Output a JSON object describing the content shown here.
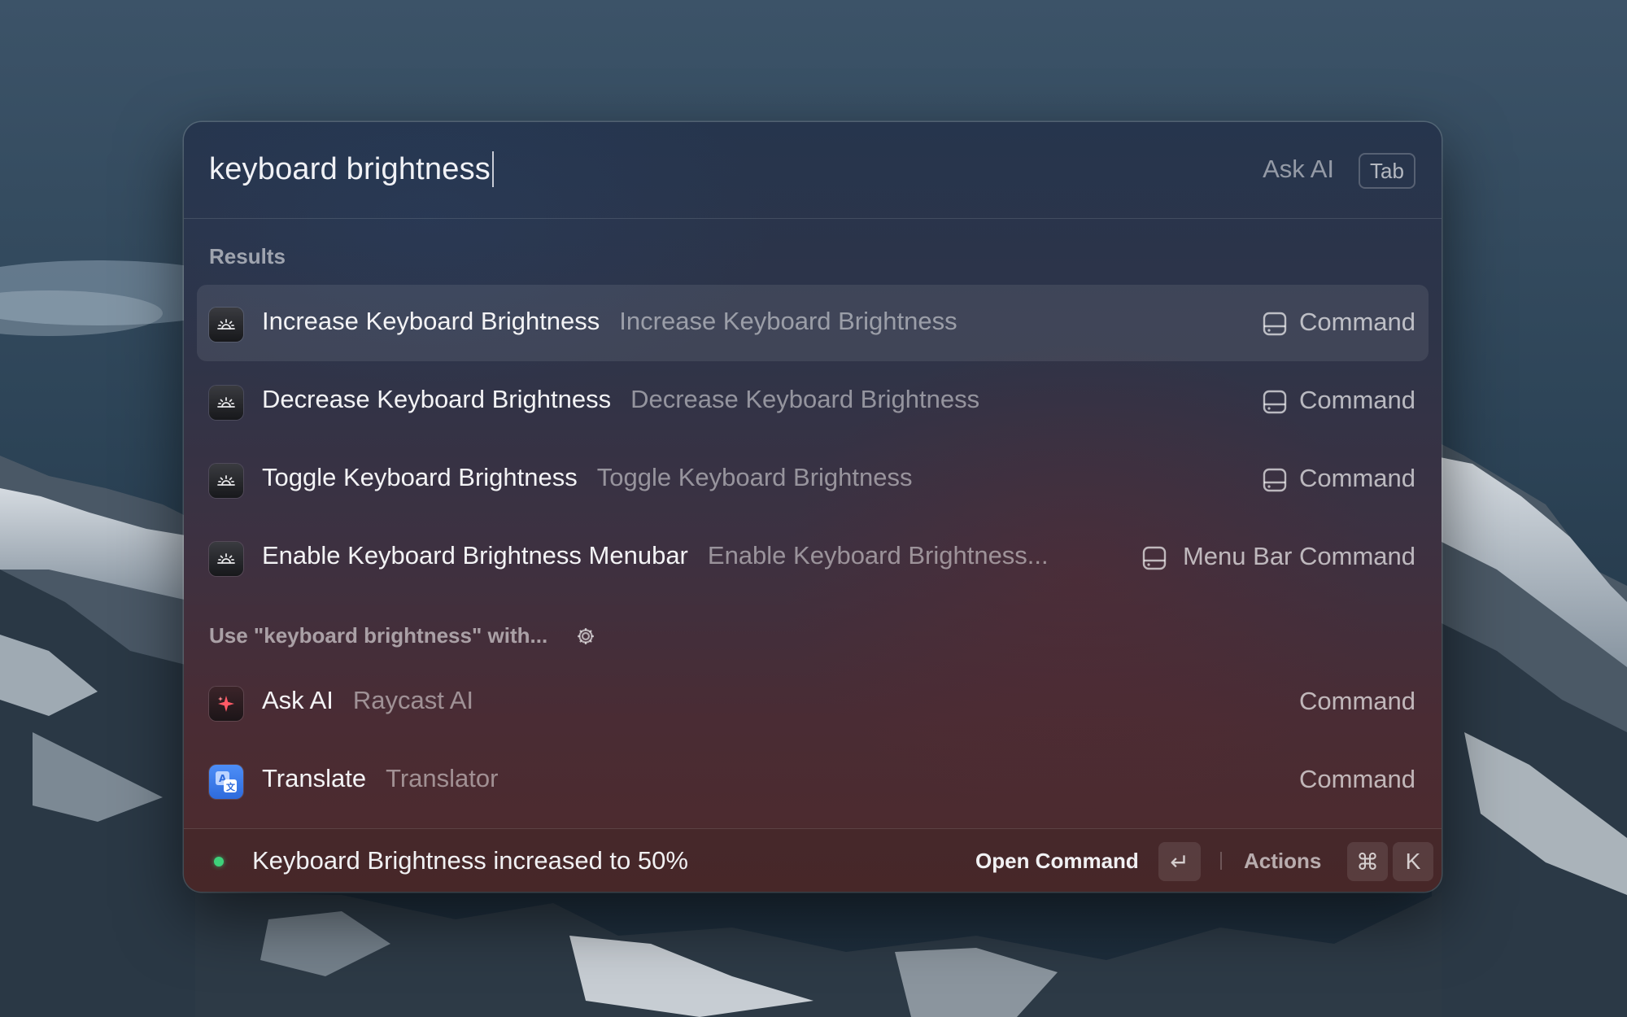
{
  "search": {
    "query": "keyboard brightness",
    "ask_ai_hint": "Ask AI",
    "tab_key": "Tab"
  },
  "results_section": {
    "header": "Results",
    "items": [
      {
        "title": "Increase Keyboard Brightness",
        "subtitle": "Increase Keyboard Brightness",
        "type": "Command",
        "selected": true,
        "icon": "keyboard-brightness-icon",
        "accessory_icon": "drive-icon"
      },
      {
        "title": "Decrease Keyboard Brightness",
        "subtitle": "Decrease Keyboard Brightness",
        "type": "Command",
        "selected": false,
        "icon": "keyboard-brightness-icon",
        "accessory_icon": "drive-icon"
      },
      {
        "title": "Toggle Keyboard Brightness",
        "subtitle": "Toggle Keyboard Brightness",
        "type": "Command",
        "selected": false,
        "icon": "keyboard-brightness-icon",
        "accessory_icon": "drive-icon"
      },
      {
        "title": "Enable Keyboard Brightness Menubar",
        "subtitle": "Enable Keyboard Brightness...",
        "type": "Menu Bar Command",
        "selected": false,
        "icon": "keyboard-brightness-icon",
        "accessory_icon": "drive-icon"
      }
    ]
  },
  "fallback_section": {
    "header": "Use \"keyboard brightness\" with...",
    "settings_icon": "gear-icon",
    "items": [
      {
        "title": "Ask AI",
        "subtitle": "Raycast AI",
        "type": "Command",
        "icon": "sparkle-icon"
      },
      {
        "title": "Translate",
        "subtitle": "Translator",
        "type": "Command",
        "icon": "translate-icon"
      }
    ]
  },
  "footer": {
    "status": "Keyboard Brightness increased to 50%",
    "status_color": "#3ed17a",
    "primary_action": "Open Command",
    "primary_key": "↵",
    "secondary_action": "Actions",
    "secondary_keys": [
      "⌘",
      "K"
    ]
  },
  "colors": {
    "accent_status": "#3ed17a",
    "translate_icon": "#3a7bee",
    "ai_icon_star": "#ff5a66"
  }
}
